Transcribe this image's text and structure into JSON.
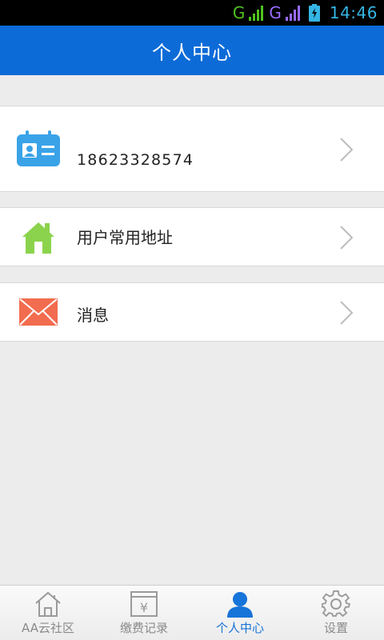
{
  "status_bar": {
    "network_1": "G",
    "network_2": "G",
    "time": "14:46",
    "accent_color": "#35b5e5"
  },
  "header": {
    "title": "个人中心",
    "background_color": "#0d6bd8"
  },
  "profile": {
    "phone": "18623328574",
    "icon": "id-card-icon"
  },
  "menu": {
    "address_label": "用户常用地址",
    "address_icon": "house-icon",
    "message_label": "消息",
    "message_icon": "envelope-icon"
  },
  "bottom_nav": {
    "items": [
      {
        "label": "AA云社区",
        "icon": "home-icon",
        "active": false
      },
      {
        "label": "缴费记录",
        "icon": "payment-record-icon",
        "active": false
      },
      {
        "label": "个人中心",
        "icon": "person-icon",
        "active": true
      },
      {
        "label": "设置",
        "icon": "gear-icon",
        "active": false
      }
    ],
    "active_color": "#1774d8"
  }
}
